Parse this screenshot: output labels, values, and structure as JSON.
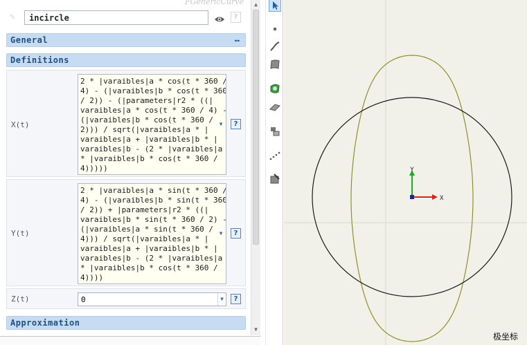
{
  "panel": {
    "title": "FGenericCurve",
    "name_value": "incircle",
    "sections": {
      "general": "General",
      "definitions": "Definitions",
      "approximation": "Approximation",
      "more": "…"
    },
    "help_label": "?",
    "dropdown_glyph": "▼",
    "x_label": "X(t)",
    "y_label": "Y(t)",
    "z_label": "Z(t)",
    "x_expr": "2 * |varaibles|a * cos(t * 360 /\n4) - (|varaibles|b * cos(t * 360\n/ 2)) - (|parameters|r2 * ((|\nvaraibles|a * cos(t * 360 / 4) -\n(|varaibles|b * cos(t * 360 /\n2))) / sqrt(|varaibles|a * |\nvaraibles|a + |varaibles|b * |\nvaraibles|b - (2 * |varaibles|a\n* |varaibles|b * cos(t * 360 /\n4)))))",
    "y_expr": "2 * |varaibles|a * sin(t * 360 /\n4) - (|varaibles|b * sin(t * 360\n/ 2)) + |parameters|r2 * ((|\nvaraibles|b * sin(t * 360 / 2) -\n(|varaibles|a * sin(t * 360 /\n4))) / sqrt(|varaibles|a * |\nvaraibles|a + |varaibles|b * |\nvaraibles|b - (2 * |varaibles|a\n* |varaibles|b * cos(t * 360 /\n4))))",
    "z_value": "0"
  },
  "toolbar": {
    "tools": [
      "select-arrow-icon",
      "point-icon",
      "curve-icon",
      "surface-icon",
      "face-icon",
      "plane-icon",
      "frame-icon",
      "dotted-line-icon",
      "clip-icon"
    ],
    "active": "select-arrow-icon"
  },
  "viewport": {
    "label": "极坐标",
    "axis_x_label": "X",
    "axis_y_label": "Y",
    "colors": {
      "background": "#f1f1e9",
      "curve": "#8f8f2a",
      "circle": "#1a1a1a",
      "axis_x": "#e02020",
      "axis_y": "#18b018",
      "origin": "#1a2a8a",
      "grid": "#d9d9cf"
    }
  }
}
